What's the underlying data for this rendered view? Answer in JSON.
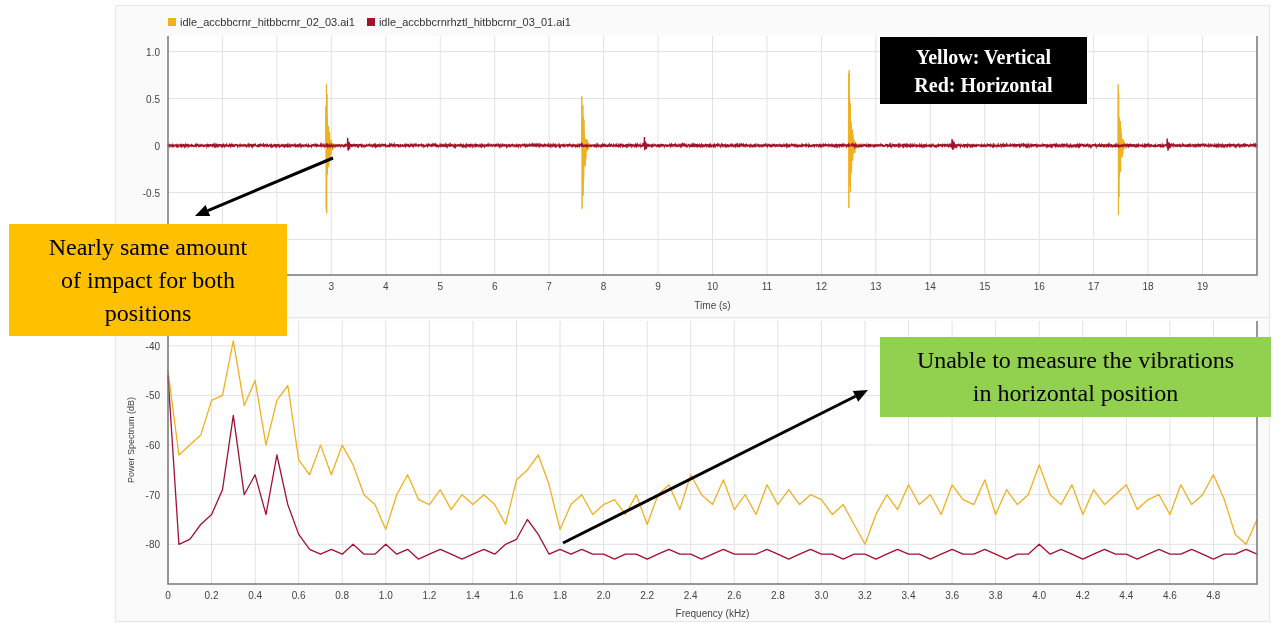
{
  "charts": [
    {
      "legend": [
        {
          "label": "idle_accbbcrnr_hitbbcrnr_02_03.ai1",
          "color": "#f0b020"
        },
        {
          "label": "idle_accbbcrnrhztl_hitbbcrnr_03_01.ai1",
          "color": "#a3112e"
        }
      ],
      "yticks": [
        "1.0",
        "0.5",
        "0",
        "-0.5"
      ],
      "xticks": [
        "3",
        "4",
        "5",
        "6",
        "7",
        "8",
        "9",
        "10",
        "11",
        "12",
        "13",
        "14",
        "15",
        "16",
        "17",
        "18",
        "19"
      ],
      "xlabel": "Time (s)"
    },
    {
      "chart_data": {
        "type": "line",
        "grid": true,
        "xlabel": "Frequency (kHz)",
        "ylabel": "Power Spectrum (dB)",
        "xlim": [
          0,
          5
        ],
        "ylim": [
          -88,
          -35
        ],
        "yticks": [
          {
            "value": -40,
            "label": "-40"
          },
          {
            "value": -50,
            "label": "-50"
          },
          {
            "value": -60,
            "label": "-60"
          },
          {
            "value": -70,
            "label": "-70"
          },
          {
            "value": -80,
            "label": "-80"
          }
        ],
        "xticks": [
          {
            "value": 0,
            "label": "0"
          },
          {
            "value": 0.2,
            "label": "0.2"
          },
          {
            "value": 0.4,
            "label": "0.4"
          },
          {
            "value": 0.6,
            "label": "0.6"
          },
          {
            "value": 0.8,
            "label": "0.8"
          },
          {
            "value": 1.0,
            "label": "1.0"
          },
          {
            "value": 1.2,
            "label": "1.2"
          },
          {
            "value": 1.4,
            "label": "1.4"
          },
          {
            "value": 1.6,
            "label": "1.6"
          },
          {
            "value": 1.8,
            "label": "1.8"
          },
          {
            "value": 2.0,
            "label": "2.0"
          },
          {
            "value": 2.2,
            "label": "2.2"
          },
          {
            "value": 2.4,
            "label": "2.4"
          },
          {
            "value": 2.6,
            "label": "2.6"
          },
          {
            "value": 2.8,
            "label": "2.8"
          },
          {
            "value": 3.0,
            "label": "3.0"
          },
          {
            "value": 3.2,
            "label": "3.2"
          },
          {
            "value": 3.4,
            "label": "3.4"
          },
          {
            "value": 3.6,
            "label": "3.6"
          },
          {
            "value": 3.8,
            "label": "3.8"
          },
          {
            "value": 4.0,
            "label": "4.0"
          },
          {
            "value": 4.2,
            "label": "4.2"
          },
          {
            "value": 4.4,
            "label": "4.4"
          },
          {
            "value": 4.6,
            "label": "4.6"
          },
          {
            "value": 4.8,
            "label": "4.8"
          }
        ],
        "x": [
          0,
          0.05,
          0.1,
          0.15,
          0.2,
          0.25,
          0.3,
          0.35,
          0.4,
          0.45,
          0.5,
          0.55,
          0.6,
          0.65,
          0.7,
          0.75,
          0.8,
          0.85,
          0.9,
          0.95,
          1.0,
          1.05,
          1.1,
          1.15,
          1.2,
          1.25,
          1.3,
          1.35,
          1.4,
          1.45,
          1.5,
          1.55,
          1.6,
          1.65,
          1.7,
          1.75,
          1.8,
          1.85,
          1.9,
          1.95,
          2.0,
          2.05,
          2.1,
          2.15,
          2.2,
          2.25,
          2.3,
          2.35,
          2.4,
          2.45,
          2.5,
          2.55,
          2.6,
          2.65,
          2.7,
          2.75,
          2.8,
          2.85,
          2.9,
          2.95,
          3.0,
          3.05,
          3.1,
          3.15,
          3.2,
          3.25,
          3.3,
          3.35,
          3.4,
          3.45,
          3.5,
          3.55,
          3.6,
          3.65,
          3.7,
          3.75,
          3.8,
          3.85,
          3.9,
          3.95,
          4.0,
          4.05,
          4.1,
          4.15,
          4.2,
          4.25,
          4.3,
          4.35,
          4.4,
          4.45,
          4.5,
          4.55,
          4.6,
          4.65,
          4.7,
          4.75,
          4.8,
          4.85,
          4.9,
          4.95,
          5.0
        ],
        "series": [
          {
            "color": "#f0b020",
            "values": [
              -45,
              -62,
              -60,
              -58,
              -51,
              -50,
              -39,
              -52,
              -47,
              -60,
              -51,
              -48,
              -63,
              -66,
              -60,
              -66,
              -60,
              -64,
              -70,
              -72,
              -77,
              -70,
              -66,
              -71,
              -72,
              -69,
              -73,
              -70,
              -72,
              -70,
              -72,
              -76,
              -67,
              -65,
              -62,
              -68,
              -77,
              -72,
              -70,
              -74,
              -72,
              -71,
              -74,
              -70,
              -76,
              -70,
              -68,
              -73,
              -66,
              -70,
              -72,
              -67,
              -73,
              -70,
              -74,
              -68,
              -72,
              -69,
              -72,
              -70,
              -71,
              -74,
              -72,
              -76,
              -80,
              -74,
              -70,
              -73,
              -68,
              -72,
              -70,
              -74,
              -68,
              -71,
              -72,
              -67,
              -74,
              -69,
              -72,
              -70,
              -64,
              -70,
              -72,
              -68,
              -74,
              -69,
              -72,
              -70,
              -68,
              -73,
              -71,
              -70,
              -74,
              -68,
              -72,
              -70,
              -66,
              -71,
              -78,
              -80,
              -75
            ]
          },
          {
            "color": "#a3112e",
            "values": [
              -46,
              -80,
              -79,
              -76,
              -74,
              -69,
              -54,
              -70,
              -66,
              -74,
              -62,
              -72,
              -78,
              -81,
              -82,
              -81,
              -82,
              -80,
              -82,
              -82,
              -80,
              -82,
              -81,
              -83,
              -82,
              -81,
              -82,
              -83,
              -82,
              -81,
              -82,
              -80,
              -79,
              -75,
              -78,
              -82,
              -81,
              -82,
              -81,
              -82,
              -82,
              -83,
              -82,
              -82,
              -83,
              -82,
              -81,
              -82,
              -82,
              -83,
              -82,
              -81,
              -82,
              -82,
              -82,
              -81,
              -82,
              -83,
              -82,
              -81,
              -82,
              -82,
              -83,
              -82,
              -82,
              -83,
              -82,
              -81,
              -82,
              -82,
              -83,
              -82,
              -81,
              -82,
              -82,
              -81,
              -82,
              -83,
              -82,
              -82,
              -80,
              -82,
              -81,
              -82,
              -83,
              -82,
              -81,
              -82,
              -82,
              -83,
              -82,
              -81,
              -82,
              -82,
              -81,
              -82,
              -83,
              -82,
              -82,
              -81,
              -82
            ]
          }
        ]
      }
    }
  ],
  "callouts": [
    {
      "kind": "key",
      "lines": [
        "Yellow: Vertical",
        "Red: Horizontal"
      ],
      "color": "#000000"
    },
    {
      "kind": "note",
      "lines": [
        "Nearly same amount",
        "of impact for both",
        "positions"
      ],
      "color": "#ffc000"
    },
    {
      "kind": "note",
      "lines": [
        "Unable to measure the vibrations",
        "in horizontal position"
      ],
      "color": "#92d050"
    }
  ]
}
